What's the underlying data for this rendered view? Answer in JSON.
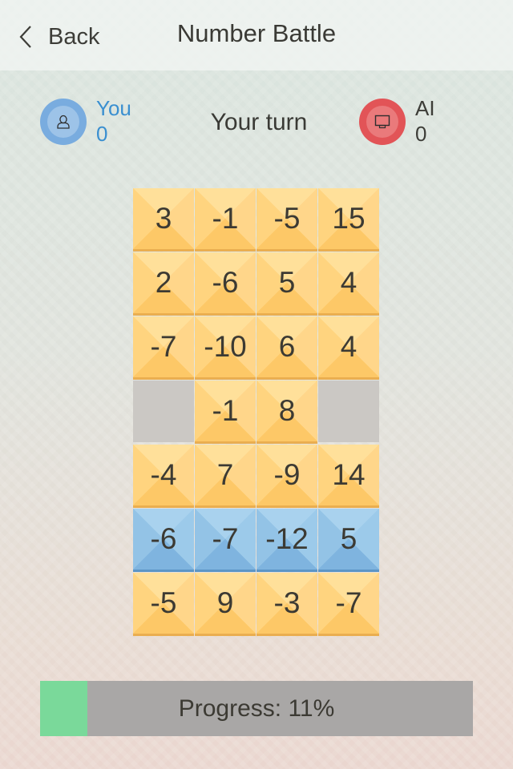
{
  "header": {
    "back_label": "Back",
    "back_icon": "chevron-left-icon",
    "title": "Number Battle"
  },
  "players": {
    "you": {
      "name": "You",
      "score": "0",
      "icon": "person-icon",
      "color": "#3a8fd0",
      "avatar_color": "#79acdf"
    },
    "ai": {
      "name": "AI",
      "score": "0",
      "icon": "monitor-icon",
      "color": "#3d3d38",
      "avatar_color": "#e25457"
    }
  },
  "status": {
    "turn_text": "Your turn"
  },
  "board": {
    "columns": 4,
    "rows": [
      [
        {
          "value": "3",
          "state": "yellow"
        },
        {
          "value": "-1",
          "state": "yellow"
        },
        {
          "value": "-5",
          "state": "yellow"
        },
        {
          "value": "15",
          "state": "yellow"
        }
      ],
      [
        {
          "value": "2",
          "state": "yellow"
        },
        {
          "value": "-6",
          "state": "yellow"
        },
        {
          "value": "5",
          "state": "yellow"
        },
        {
          "value": "4",
          "state": "yellow"
        }
      ],
      [
        {
          "value": "-7",
          "state": "yellow"
        },
        {
          "value": "-10",
          "state": "yellow"
        },
        {
          "value": "6",
          "state": "yellow"
        },
        {
          "value": "4",
          "state": "yellow"
        }
      ],
      [
        {
          "value": "",
          "state": "empty"
        },
        {
          "value": "-1",
          "state": "yellow"
        },
        {
          "value": "8",
          "state": "yellow"
        },
        {
          "value": "",
          "state": "empty"
        }
      ],
      [
        {
          "value": "-4",
          "state": "yellow"
        },
        {
          "value": "7",
          "state": "yellow"
        },
        {
          "value": "-9",
          "state": "yellow"
        },
        {
          "value": "14",
          "state": "yellow"
        }
      ],
      [
        {
          "value": "-6",
          "state": "blue"
        },
        {
          "value": "-7",
          "state": "blue"
        },
        {
          "value": "-12",
          "state": "blue"
        },
        {
          "value": "5",
          "state": "blue"
        }
      ],
      [
        {
          "value": "-5",
          "state": "yellow"
        },
        {
          "value": "9",
          "state": "yellow"
        },
        {
          "value": "-3",
          "state": "yellow"
        },
        {
          "value": "-7",
          "state": "yellow"
        }
      ]
    ],
    "colors": {
      "yellow": "#ffd47f",
      "blue": "#93c3e6",
      "empty": "#cbc8c4"
    }
  },
  "progress": {
    "label": "Progress: 11%",
    "percent": 11,
    "fill_color": "#7ad99a",
    "track_color": "#a9a7a6"
  }
}
